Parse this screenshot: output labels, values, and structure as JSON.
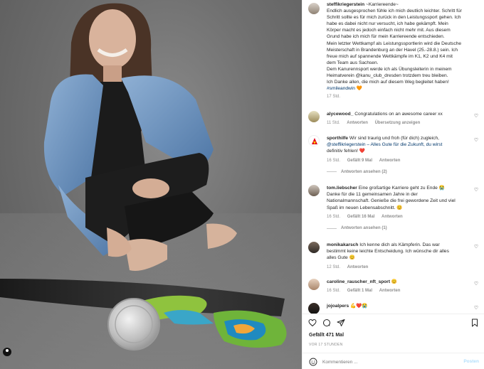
{
  "post": {
    "username": "steffikriegerstein",
    "caption_lines": [
      "~Karriereende~",
      "Endlich ausgesprochen fühle ich mich deutlich leichter. Schritt für",
      "Schritt sollte es für mich zurück in den Leistungssport gehen. Ich",
      "habe es dabei nicht nur versucht, ich habe gekämpft. Mein",
      "Körper macht es jedoch einfach nicht mehr mit. Aus diesem",
      "Grund habe ich mich für mein Karriereende entschieden.",
      "Mein letzter Wettkampf als Leistungssportlerin wird die Deutsche",
      "Meisterschaft in Brandenburg an der Havel (25.-28.8.) sein. Ich",
      "freue mich auf spannende Wettkämpfe im K1, K2 und K4 mit",
      "dem Team aus Sachsen.",
      "Dem Kanurennsport werde ich als Übungsleiterin in meinem",
      "Heimatverein @kanu_club_dresden trotzdem treu bleiben.",
      "Ich Danke allen, die mich auf diesem Weg begleitet haben!"
    ],
    "hashtag": "#smileandwin",
    "hashtag_emoji": "🧡",
    "time": "17 Std."
  },
  "comments": [
    {
      "user": "alycewood_",
      "text": "Congratulations on an awesome career xx",
      "time": "11 Std.",
      "reply_label": "Antworten",
      "extra": "Übersetzung anzeigen",
      "likes": ""
    },
    {
      "user": "sporthilfe",
      "text_lines": [
        "Wir sind traurig und froh (für dich) zugleich,",
        "@steffikriegerstein – Alles Gute für die Zukunft, du wirst",
        "definitiv fehlen! ❤️"
      ],
      "time": "16 Std.",
      "likes": "Gefällt 9 Mal",
      "reply_label": "Antworten",
      "replies": "Antworten ansehen (2)"
    },
    {
      "user": "tom.liebscher",
      "text_lines": [
        "Eine großartige Karriere geht zu Ende 😭",
        "Danke für die 11 gemeinsamen Jahre in der",
        "Nationalmannschaft. Genieße die frei gewordene Zeit und viel",
        "Spaß im neuen Lebensabschnitt. 😊"
      ],
      "time": "16 Std.",
      "likes": "Gefällt 16 Mal",
      "reply_label": "Antworten",
      "replies": "Antworten ansehen (1)"
    },
    {
      "user": "monikakarsch",
      "text_lines": [
        "Ich kenne dich als Kämpferin. Das war",
        "bestimmt keine leichte Entscheidung. Ich wünsche dir alles",
        "alles Gute 😊"
      ],
      "time": "12 Std.",
      "likes": "",
      "reply_label": "Antworten"
    },
    {
      "user": "caroline_rauscher_nft_sport",
      "text": "😊",
      "time": "16 Std.",
      "likes": "Gefällt 1 Mal",
      "reply_label": "Antworten"
    },
    {
      "user": "jojoalpers",
      "text": "💪❤️😭",
      "time": "",
      "likes": "",
      "reply_label": ""
    }
  ],
  "actions": {
    "likes": "Gefällt 471 Mal",
    "date": "VOR 17 STUNDEN",
    "comment_placeholder": "Kommentieren ...",
    "post_label": "Posten"
  },
  "colors": {
    "link": "#00376b",
    "muted": "#8e8e8e",
    "post_button": "#b2dffc"
  }
}
